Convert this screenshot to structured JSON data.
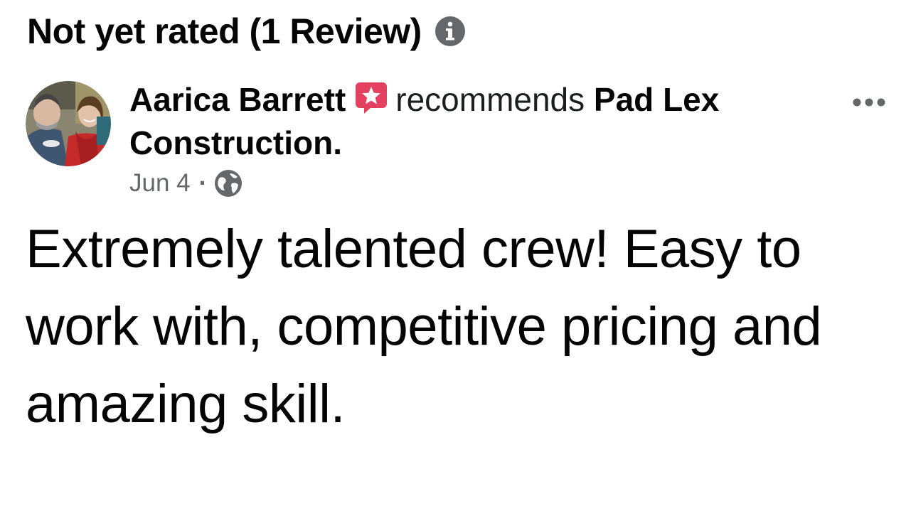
{
  "header": {
    "title": "Not yet rated (1 Review)",
    "info_icon": "info-circle-icon"
  },
  "review": {
    "author": {
      "name": "Aarica Barrett",
      "badge_icon": "rising-star-badge-icon",
      "avatar_icon": "profile-photo"
    },
    "verb": "recommends",
    "page_name_line1": "Pad Lex",
    "page_name_line2": "Construction.",
    "date": "Jun 4",
    "separator": "·",
    "audience_icon": "globe-icon",
    "more_icon": "more-options-icon",
    "text": "Extremely talented crew! Easy to work with, competitive pricing and amazing skill."
  },
  "colors": {
    "text_primary": "#050505",
    "text_secondary": "#65676b",
    "badge": "#e4405f",
    "info_icon": "#65676b"
  }
}
